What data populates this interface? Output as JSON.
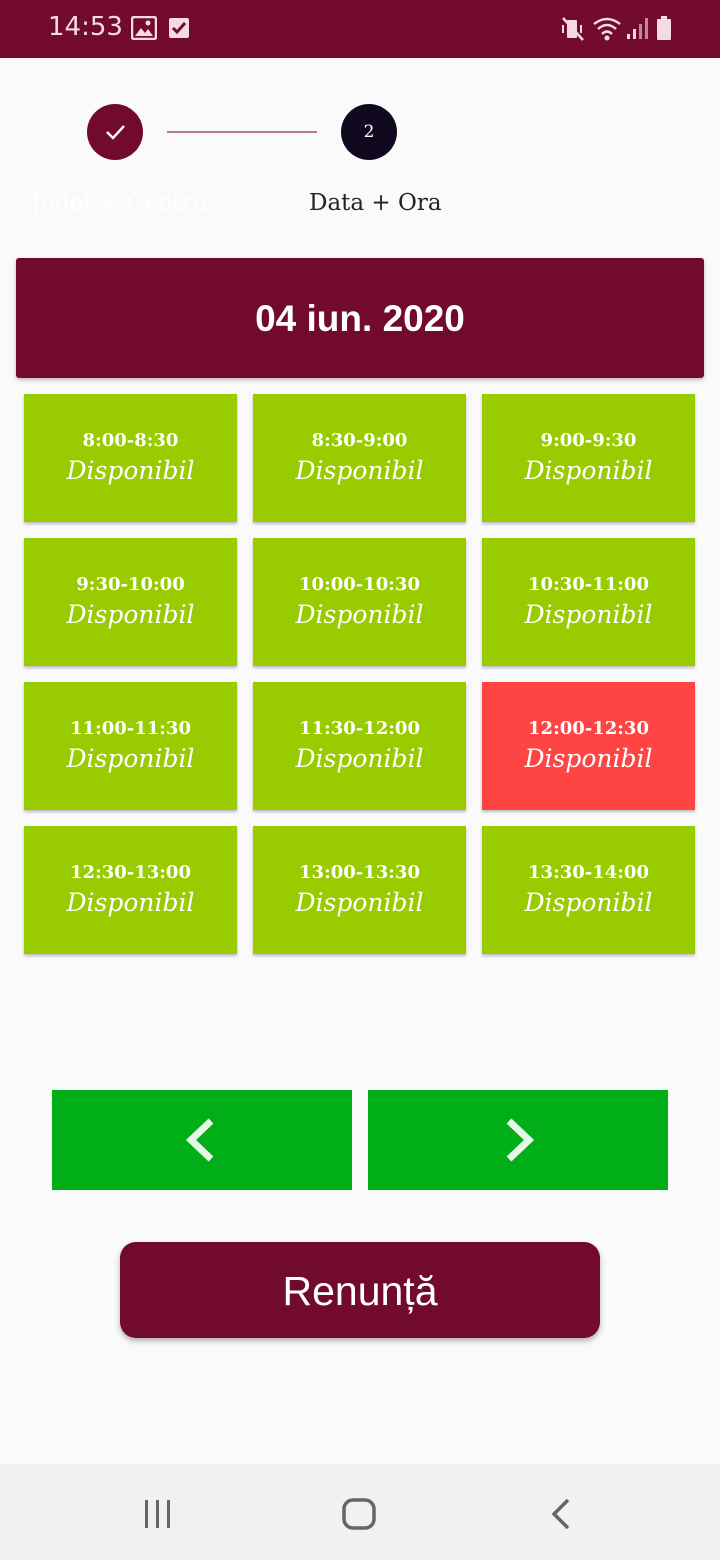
{
  "status_bar": {
    "time": "14:53",
    "left_icons": [
      "image-icon",
      "checkbox-icon"
    ],
    "right_icons": [
      "mute-vibrate-icon",
      "wifi-icon",
      "signal-icon",
      "battery-icon"
    ]
  },
  "stepper": {
    "steps": [
      {
        "label": "Județ + Centru",
        "state": "completed",
        "icon": "check-icon"
      },
      {
        "label": "Data + Ora",
        "number": "2",
        "state": "active"
      }
    ]
  },
  "date_header": "04 iun. 2020",
  "slots": [
    {
      "time": "8:00-8:30",
      "status": "Disponibil",
      "color": "#99cc00"
    },
    {
      "time": "8:30-9:00",
      "status": "Disponibil",
      "color": "#99cc00"
    },
    {
      "time": "9:00-9:30",
      "status": "Disponibil",
      "color": "#99cc00"
    },
    {
      "time": "9:30-10:00",
      "status": "Disponibil",
      "color": "#99cc00"
    },
    {
      "time": "10:00-10:30",
      "status": "Disponibil",
      "color": "#99cc00"
    },
    {
      "time": "10:30-11:00",
      "status": "Disponibil",
      "color": "#99cc00"
    },
    {
      "time": "11:00-11:30",
      "status": "Disponibil",
      "color": "#99cc00"
    },
    {
      "time": "11:30-12:00",
      "status": "Disponibil",
      "color": "#99cc00"
    },
    {
      "time": "12:00-12:30",
      "status": "Disponibil",
      "color": "#ff4444"
    },
    {
      "time": "12:30-13:00",
      "status": "Disponibil",
      "color": "#99cc00"
    },
    {
      "time": "13:00-13:30",
      "status": "Disponibil",
      "color": "#99cc00"
    },
    {
      "time": "13:30-14:00",
      "status": "Disponibil",
      "color": "#99cc00"
    }
  ],
  "navigation": {
    "prev_icon": "chevron-left-icon",
    "next_icon": "chevron-right-icon",
    "color": "#00ae17"
  },
  "cancel_label": "Renunță",
  "colors": {
    "brand": "#720a2f",
    "available": "#99cc00",
    "selected": "#ff4444",
    "nav_green": "#00ae17"
  },
  "system_nav": [
    "recent-apps-icon",
    "home-icon",
    "back-icon"
  ]
}
